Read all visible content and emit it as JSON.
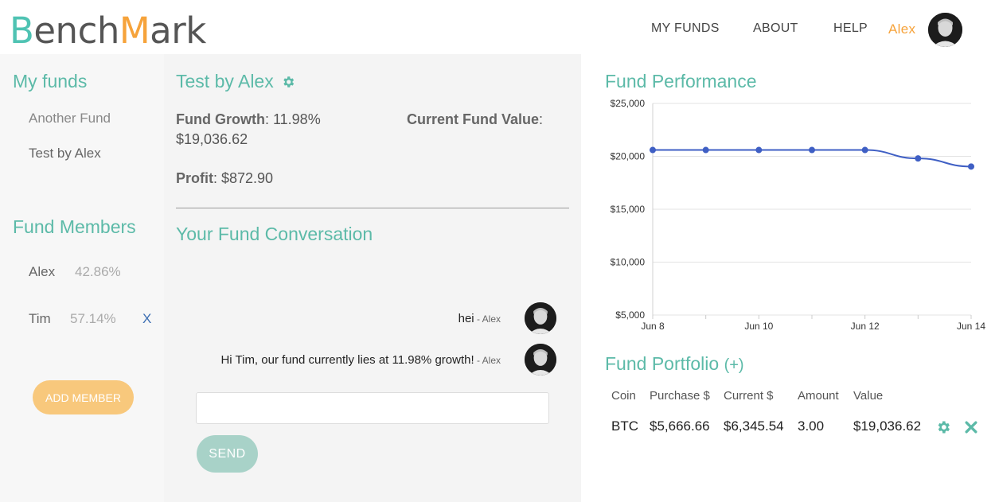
{
  "header": {
    "logo": {
      "part1": "B",
      "part2": "ench",
      "part3": "M",
      "part4": "ark"
    },
    "nav": {
      "my_funds": "MY FUNDS",
      "about": "ABOUT",
      "help": "HELP",
      "user": "Alex"
    }
  },
  "sidebar": {
    "my_funds_title": "My funds",
    "funds": [
      {
        "label": "Another Fund"
      },
      {
        "label": "Test by Alex"
      }
    ],
    "members_title": "Fund Members",
    "members": [
      {
        "name": "Alex",
        "share": "42.86%"
      },
      {
        "name": "Tim",
        "share": "57.14%",
        "remove": "X"
      }
    ],
    "add_member_label": "ADD MEMBER"
  },
  "fund": {
    "title": "Test by Alex",
    "growth_label": "Fund Growth",
    "growth_value": ": 11.98%",
    "value_label": "Current Fund Value",
    "value_colon": ":",
    "value_amount": "$19,036.62",
    "profit_label": "Profit",
    "profit_value": ": $872.90"
  },
  "conversation": {
    "title": "Your Fund Conversation",
    "messages": [
      {
        "text": "hei",
        "author": " - Alex"
      },
      {
        "text": "Hi Tim, our fund currently lies at 11.98% growth!",
        "author": " - Alex"
      }
    ],
    "input_value": "",
    "send_label": "SEND"
  },
  "performance": {
    "title": "Fund Performance"
  },
  "chart_data": {
    "type": "line",
    "x": [
      "Jun 8",
      "Jun 9",
      "Jun 10",
      "Jun 11",
      "Jun 12",
      "Jun 13",
      "Jun 14"
    ],
    "x_tick_labels": [
      "Jun 8",
      "Jun 10",
      "Jun 12",
      "Jun 14"
    ],
    "y_tick_labels": [
      "$25,000",
      "$20,000",
      "$15,000",
      "$10,000",
      "$5,000"
    ],
    "y_ticks": [
      25000,
      20000,
      15000,
      10000,
      5000
    ],
    "series": [
      {
        "values": [
          20600,
          20600,
          20600,
          20600,
          20600,
          19800,
          19036.62
        ]
      }
    ],
    "ylim": [
      5000,
      25000
    ],
    "grid": true,
    "line_color": "#3f5fc4"
  },
  "portfolio": {
    "title": "Fund Portfolio",
    "add_label": "(+)",
    "columns": [
      "Coin",
      "Purchase $",
      "Current $",
      "Amount",
      "Value"
    ],
    "rows": [
      {
        "coin": "BTC",
        "purchase": "$5,666.66",
        "current": "$6,345.54",
        "amount": "3.00",
        "value": "$19,036.62"
      }
    ],
    "icons": {
      "edit": "gear-icon",
      "delete": "close-icon"
    }
  },
  "colors": {
    "teal": "#5cbaa8",
    "orange": "#f6a33b",
    "button_orange": "#f8c87c",
    "button_teal": "#a8d2c8"
  }
}
